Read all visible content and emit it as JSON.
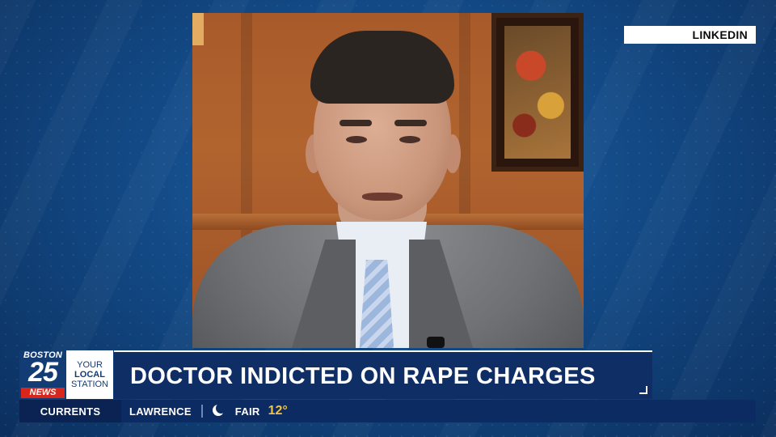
{
  "source_tag": "LINKEDIN",
  "logo": {
    "city": "BOSTON",
    "number": "25",
    "news": "NEWS",
    "tagline_1": "YOUR",
    "tagline_2": "LOCAL",
    "tagline_3": "STATION"
  },
  "headline": "DOCTOR INDICTED ON RAPE CHARGES",
  "ticker": {
    "label": "CURRENTS",
    "city": "LAWRENCE",
    "weather_icon": "moon-icon",
    "condition": "FAIR",
    "temperature": "12°"
  },
  "colors": {
    "brand_navy": "#0f2e66",
    "news_red": "#d9261c",
    "temp_yellow": "#f6c23b"
  }
}
